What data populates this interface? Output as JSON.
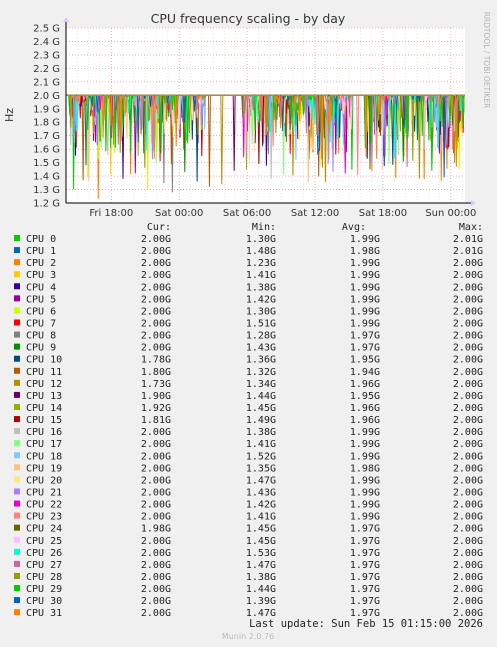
{
  "chart_data": {
    "type": "line",
    "title": "CPU frequency scaling - by day",
    "ylabel": "Hz",
    "side_label": "RRDTOOL / TOBI OETIKER",
    "ylim": [
      1.2,
      2.5
    ],
    "y_ticks": [
      "1.2 G",
      "1.3 G",
      "1.4 G",
      "1.5 G",
      "1.6 G",
      "1.7 G",
      "1.8 G",
      "1.9 G",
      "2.0 G",
      "2.1 G",
      "2.2 G",
      "2.3 G",
      "2.4 G",
      "2.5 G"
    ],
    "y_tick_values": [
      1.2,
      1.3,
      1.4,
      1.5,
      1.6,
      1.7,
      1.8,
      1.9,
      2.0,
      2.1,
      2.2,
      2.3,
      2.4,
      2.5
    ],
    "x_ticks": [
      "Fri 18:00",
      "Sat 00:00",
      "Sat 06:00",
      "Sat 12:00",
      "Sat 18:00",
      "Sun 00:00"
    ],
    "x_tick_hours": [
      4,
      10,
      16,
      22,
      28,
      34
    ],
    "x_range_hours": [
      0,
      35.25
    ],
    "baseline": 2.0,
    "unit": "G",
    "legend_headers": {
      "cur": "Cur:",
      "min": "Min:",
      "avg": "Avg:",
      "max": "Max:"
    },
    "series": [
      {
        "name": "CPU 0",
        "color": "#00cc00",
        "cur": "2.00G",
        "min": "1.30G",
        "avg": "1.99G",
        "max": "2.01G"
      },
      {
        "name": "CPU 1",
        "color": "#0066b3",
        "cur": "2.00G",
        "min": "1.48G",
        "avg": "1.98G",
        "max": "2.01G"
      },
      {
        "name": "CPU 2",
        "color": "#ff8000",
        "cur": "2.00G",
        "min": "1.23G",
        "avg": "1.99G",
        "max": "2.00G"
      },
      {
        "name": "CPU 3",
        "color": "#ffcc00",
        "cur": "2.00G",
        "min": "1.41G",
        "avg": "1.99G",
        "max": "2.00G"
      },
      {
        "name": "CPU 4",
        "color": "#330099",
        "cur": "2.00G",
        "min": "1.38G",
        "avg": "1.99G",
        "max": "2.00G"
      },
      {
        "name": "CPU 5",
        "color": "#990099",
        "cur": "2.00G",
        "min": "1.42G",
        "avg": "1.99G",
        "max": "2.00G"
      },
      {
        "name": "CPU 6",
        "color": "#ccff00",
        "cur": "2.00G",
        "min": "1.30G",
        "avg": "1.99G",
        "max": "2.00G"
      },
      {
        "name": "CPU 7",
        "color": "#ff0000",
        "cur": "2.00G",
        "min": "1.51G",
        "avg": "1.99G",
        "max": "2.00G"
      },
      {
        "name": "CPU 8",
        "color": "#808080",
        "cur": "2.00G",
        "min": "1.28G",
        "avg": "1.97G",
        "max": "2.00G"
      },
      {
        "name": "CPU 9",
        "color": "#008f00",
        "cur": "2.00G",
        "min": "1.43G",
        "avg": "1.97G",
        "max": "2.00G"
      },
      {
        "name": "CPU 10",
        "color": "#00487d",
        "cur": "1.78G",
        "min": "1.36G",
        "avg": "1.95G",
        "max": "2.00G"
      },
      {
        "name": "CPU 11",
        "color": "#b35a00",
        "cur": "1.80G",
        "min": "1.32G",
        "avg": "1.94G",
        "max": "2.00G"
      },
      {
        "name": "CPU 12",
        "color": "#b38f00",
        "cur": "1.73G",
        "min": "1.34G",
        "avg": "1.96G",
        "max": "2.00G"
      },
      {
        "name": "CPU 13",
        "color": "#6b006b",
        "cur": "1.90G",
        "min": "1.44G",
        "avg": "1.95G",
        "max": "2.00G"
      },
      {
        "name": "CPU 14",
        "color": "#8fb300",
        "cur": "1.92G",
        "min": "1.45G",
        "avg": "1.96G",
        "max": "2.00G"
      },
      {
        "name": "CPU 15",
        "color": "#b30000",
        "cur": "1.81G",
        "min": "1.49G",
        "avg": "1.96G",
        "max": "2.00G"
      },
      {
        "name": "CPU 16",
        "color": "#bebebe",
        "cur": "2.00G",
        "min": "1.38G",
        "avg": "1.99G",
        "max": "2.00G"
      },
      {
        "name": "CPU 17",
        "color": "#80ff80",
        "cur": "2.00G",
        "min": "1.41G",
        "avg": "1.99G",
        "max": "2.00G"
      },
      {
        "name": "CPU 18",
        "color": "#80c9ff",
        "cur": "2.00G",
        "min": "1.52G",
        "avg": "1.99G",
        "max": "2.00G"
      },
      {
        "name": "CPU 19",
        "color": "#ffc080",
        "cur": "2.00G",
        "min": "1.35G",
        "avg": "1.98G",
        "max": "2.00G"
      },
      {
        "name": "CPU 20",
        "color": "#ffe680",
        "cur": "2.00G",
        "min": "1.47G",
        "avg": "1.99G",
        "max": "2.00G"
      },
      {
        "name": "CPU 21",
        "color": "#aa80ff",
        "cur": "2.00G",
        "min": "1.43G",
        "avg": "1.99G",
        "max": "2.00G"
      },
      {
        "name": "CPU 22",
        "color": "#ee00cc",
        "cur": "2.00G",
        "min": "1.42G",
        "avg": "1.99G",
        "max": "2.00G"
      },
      {
        "name": "CPU 23",
        "color": "#ff8080",
        "cur": "2.00G",
        "min": "1.41G",
        "avg": "1.99G",
        "max": "2.00G"
      },
      {
        "name": "CPU 24",
        "color": "#666600",
        "cur": "1.98G",
        "min": "1.45G",
        "avg": "1.97G",
        "max": "2.00G"
      },
      {
        "name": "CPU 25",
        "color": "#ffbfff",
        "cur": "2.00G",
        "min": "1.45G",
        "avg": "1.97G",
        "max": "2.00G"
      },
      {
        "name": "CPU 26",
        "color": "#00ffcc",
        "cur": "2.00G",
        "min": "1.53G",
        "avg": "1.97G",
        "max": "2.00G"
      },
      {
        "name": "CPU 27",
        "color": "#cc6699",
        "cur": "2.00G",
        "min": "1.47G",
        "avg": "1.97G",
        "max": "2.00G"
      },
      {
        "name": "CPU 28",
        "color": "#999900",
        "cur": "2.00G",
        "min": "1.38G",
        "avg": "1.97G",
        "max": "2.00G"
      },
      {
        "name": "CPU 29",
        "color": "#00cc00",
        "cur": "2.00G",
        "min": "1.44G",
        "avg": "1.97G",
        "max": "2.00G"
      },
      {
        "name": "CPU 30",
        "color": "#0066b3",
        "cur": "2.00G",
        "min": "1.39G",
        "avg": "1.97G",
        "max": "2.00G"
      },
      {
        "name": "CPU 31",
        "color": "#ff8000",
        "cur": "2.00G",
        "min": "1.47G",
        "avg": "1.97G",
        "max": "2.00G"
      }
    ]
  },
  "footer": {
    "last_update": "Last update:  Sun Feb 15 01:15:00 2026",
    "munin_version": "Munin 2.0.76"
  }
}
